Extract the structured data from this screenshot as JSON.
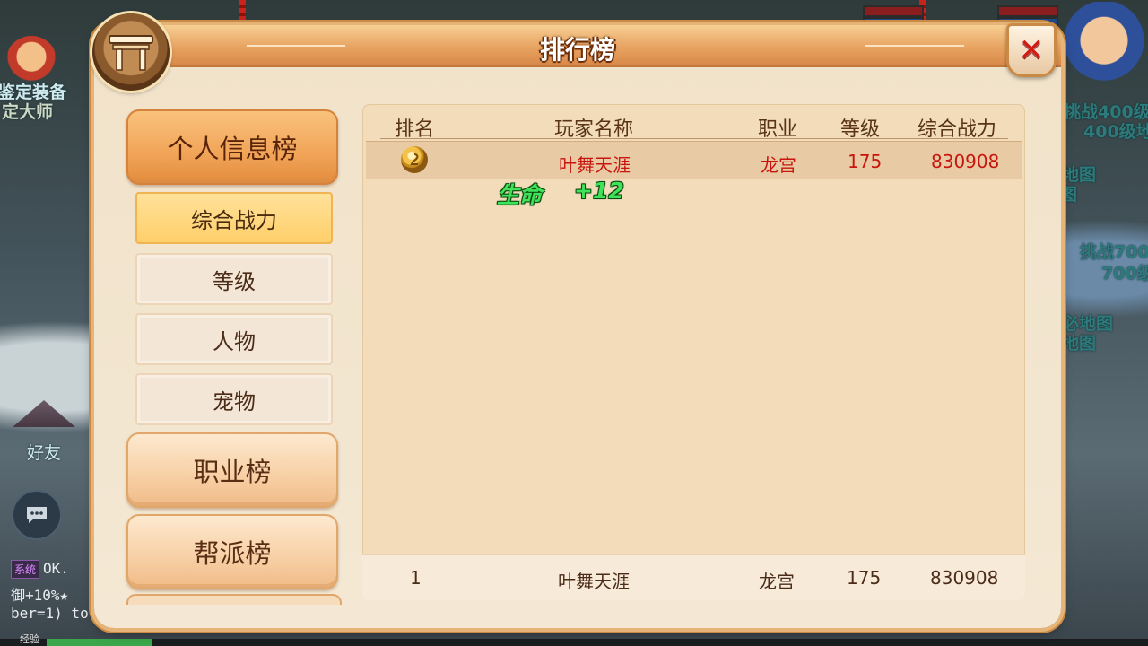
{
  "background": {
    "left_labels": [
      "鉴定装备",
      "定大师"
    ],
    "right_labels": [
      "挑战400级",
      "400级地",
      "地图",
      "图",
      "挑战700",
      "700级",
      "必地图",
      "地图"
    ],
    "friend_label": "好友",
    "chat_lines": [
      {
        "badge": "系统",
        "text": "OK."
      },
      {
        "text": "御+10%★"
      },
      {
        "text": "ber=1) to"
      }
    ],
    "exp_label": "经验"
  },
  "panel": {
    "title": "排行榜",
    "close_symbol": "✕"
  },
  "nav": {
    "personal": "个人信息榜",
    "sub_items": [
      "综合战力",
      "等级",
      "人物",
      "宠物"
    ],
    "job": "职业榜",
    "guild": "帮派榜"
  },
  "table": {
    "headers": [
      "排名",
      "玩家名称",
      "职业",
      "等级",
      "综合战力"
    ],
    "rows": [
      {
        "rank_icon": "gold-medal-icon",
        "name": "叶舞天涯",
        "job": "龙宫",
        "level": "175",
        "power": "830908"
      }
    ],
    "my_rank": {
      "rank": "1",
      "name": "叶舞天涯",
      "job": "龙宫",
      "level": "175",
      "power": "830908"
    }
  },
  "floating": {
    "label": "生命",
    "value": "+12"
  },
  "colors": {
    "highlight_red": "#c8160e",
    "title_orange": "#e8a463",
    "float_green": "#3fe35a"
  }
}
